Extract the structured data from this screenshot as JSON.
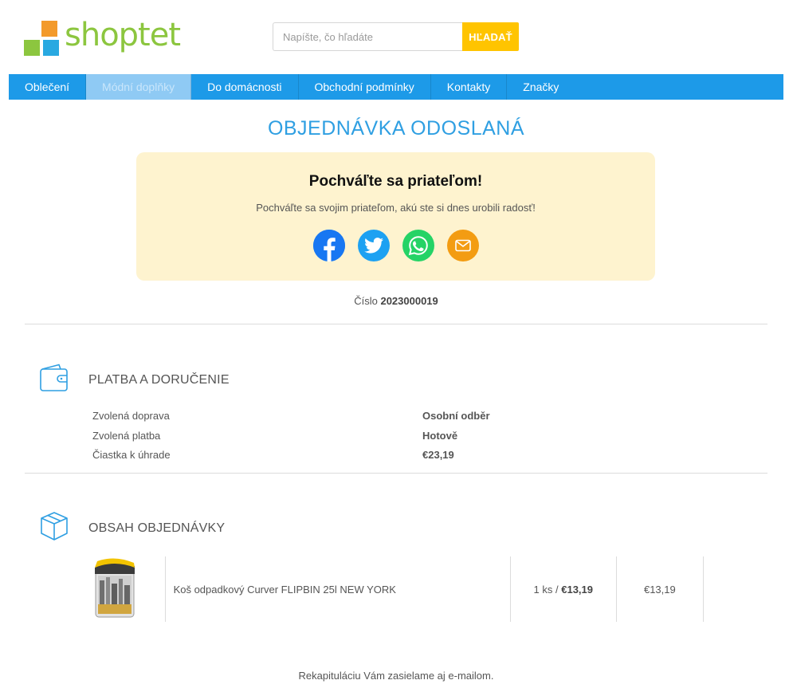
{
  "header": {
    "logo_text": "shoptet",
    "search": {
      "placeholder": "Napíšte, čo hľadáte",
      "button_label": "HĽADAŤ"
    }
  },
  "nav": {
    "items": [
      {
        "label": "Oblečení"
      },
      {
        "label": "Módní doplňky"
      },
      {
        "label": "Do domácnosti"
      },
      {
        "label": "Obchodní podmínky"
      },
      {
        "label": "Kontakty"
      },
      {
        "label": "Značky"
      }
    ],
    "active_index": 1
  },
  "page": {
    "title": "OBJEDNÁVKA ODOSLANÁ"
  },
  "share": {
    "title": "Pochváľte sa priateľom!",
    "text": "Pochváľte sa svojim priateľom, akú ste si dnes urobili radosť!",
    "icons": [
      "facebook-icon",
      "twitter-icon",
      "whatsapp-icon",
      "email-icon"
    ],
    "colors": {
      "facebook": "#1877f2",
      "twitter": "#1da1f2",
      "whatsapp": "#25d366",
      "email": "#f39c12"
    }
  },
  "order": {
    "number_label": "Číslo",
    "number": "2023000019"
  },
  "payment_section": {
    "title": "PLATBA A DORUČENIE",
    "icon": "wallet-icon",
    "rows": [
      {
        "label": "Zvolená doprava",
        "value": "Osobní odběr"
      },
      {
        "label": "Zvolená platba",
        "value": "Hotově"
      },
      {
        "label": "Čiastka k úhrade",
        "value": "€23,19"
      }
    ]
  },
  "contents_section": {
    "title": "OBSAH OBJEDNÁVKY",
    "icon": "box-icon",
    "items": [
      {
        "name": "Koš odpadkový Curver FLIPBIN 25l NEW YORK",
        "qty": "1 ks /",
        "unit_price": "€13,19",
        "total": "€13,19"
      }
    ]
  },
  "footer": {
    "note": "Rekapituláciu Vám zasielame aj e-mailom."
  },
  "colors": {
    "accent": "#1d9ae8",
    "title": "#2f9fe2",
    "search_button": "#ffc400",
    "share_box_bg": "#fef3cf"
  }
}
